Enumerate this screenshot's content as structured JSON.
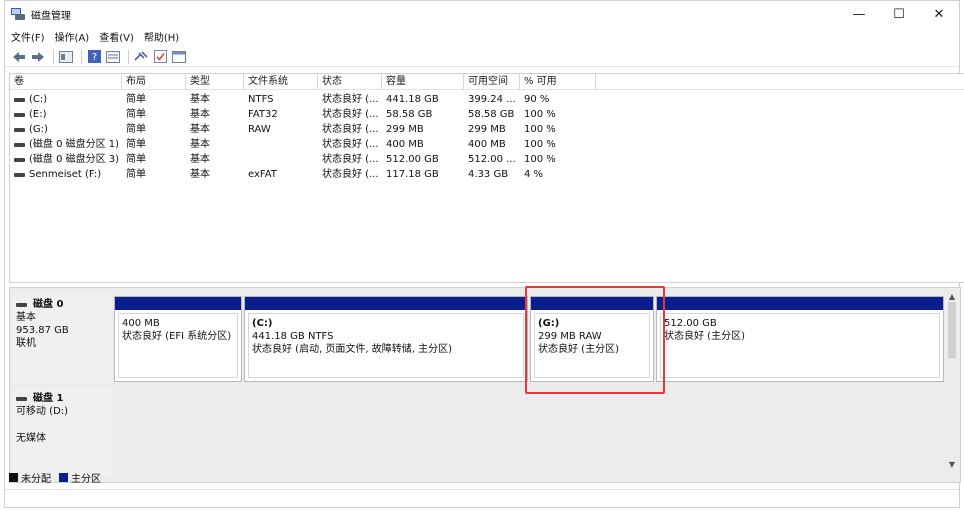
{
  "window": {
    "title": "磁盘管理",
    "controls": [
      "—",
      "☐",
      "✕"
    ]
  },
  "menu": [
    "文件(F)",
    "操作(A)",
    "查看(V)",
    "帮助(H)"
  ],
  "volumes": {
    "columns": [
      "卷",
      "布局",
      "类型",
      "文件系统",
      "状态",
      "容量",
      "可用空间",
      "% 可用"
    ],
    "rows": [
      [
        "(C:)",
        "简单",
        "基本",
        "NTFS",
        "状态良好 (...",
        "441.18 GB",
        "399.24 ...",
        "90 %"
      ],
      [
        "(E:)",
        "简单",
        "基本",
        "FAT32",
        "状态良好 (...",
        "58.58 GB",
        "58.58 GB",
        "100 %"
      ],
      [
        "(G:)",
        "简单",
        "基本",
        "RAW",
        "状态良好 (...",
        "299 MB",
        "299 MB",
        "100 %"
      ],
      [
        "(磁盘 0 磁盘分区 1)",
        "简单",
        "基本",
        "",
        "状态良好 (...",
        "400 MB",
        "400 MB",
        "100 %"
      ],
      [
        "(磁盘 0 磁盘分区 3)",
        "简单",
        "基本",
        "",
        "状态良好 (...",
        "512.00 GB",
        "512.00 ...",
        "100 %"
      ],
      [
        "Senmeiset (F:)",
        "简单",
        "基本",
        "exFAT",
        "状态良好 (...",
        "117.18 GB",
        "4.33 GB",
        "4 %"
      ]
    ]
  },
  "disk0": {
    "name": "磁盘 0",
    "type": "基本",
    "size": "953.87 GB",
    "status": "联机",
    "partitions": [
      {
        "name": "",
        "size": "400 MB",
        "status": "状态良好 (EFI 系统分区)"
      },
      {
        "name": "(C:)",
        "size": "441.18 GB NTFS",
        "status": "状态良好 (启动, 页面文件, 故障转储, 主分区)"
      },
      {
        "name": "(G:)",
        "size": "299 MB RAW",
        "status": "状态良好 (主分区)"
      },
      {
        "name": "",
        "size": "512.00 GB",
        "status": "状态良好 (主分区)"
      }
    ]
  },
  "disk1": {
    "name": "磁盘 1",
    "type": "可移动 (D:)",
    "status": "无媒体"
  },
  "legend": [
    {
      "label": "未分配",
      "color": "#111111"
    },
    {
      "label": "主分区",
      "color": "#0b1f8c"
    }
  ],
  "colors": {
    "partition_bar": "#0b1f8c",
    "highlight": "#e53935"
  }
}
